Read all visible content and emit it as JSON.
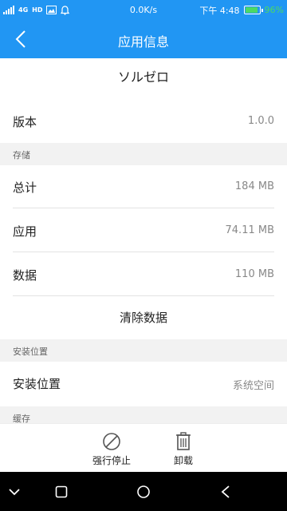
{
  "statusbar": {
    "network_type": "4G",
    "hd_label": "HD",
    "speed": "0.0K/s",
    "time": "下午 4:48",
    "battery_pct": "96%",
    "battery_level": 0.96,
    "icons": [
      "signal-icon",
      "image-icon",
      "notification-bell-icon",
      "battery-icon"
    ]
  },
  "header": {
    "title": "应用信息",
    "back_icon": "chevron-left-icon"
  },
  "app": {
    "name": "ソルゼロ"
  },
  "version_row": {
    "label": "版本",
    "value": "1.0.0"
  },
  "storage": {
    "section_label": "存储",
    "rows": [
      {
        "label": "总计",
        "value": "184 MB"
      },
      {
        "label": "应用",
        "value": "74.11 MB"
      },
      {
        "label": "数据",
        "value": "110 MB"
      }
    ],
    "clear_label": "清除数据"
  },
  "install": {
    "section_label": "安装位置",
    "label": "安装位置",
    "value": "系统空间"
  },
  "cache": {
    "section_label": "缓存"
  },
  "actions": {
    "force_stop": "强行停止",
    "uninstall": "卸载"
  },
  "colors": {
    "accent": "#2196f3",
    "battery": "#4cd964"
  }
}
